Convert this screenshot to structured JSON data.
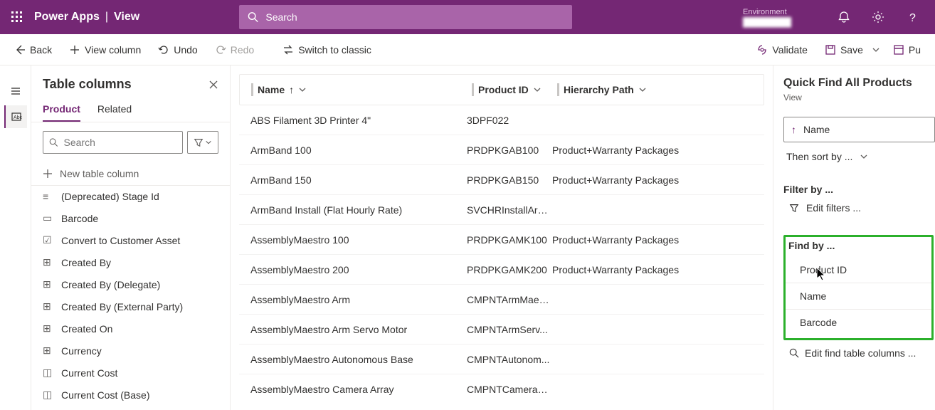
{
  "header": {
    "app_name": "Power Apps",
    "section": "View",
    "search_placeholder": "Search",
    "env_label": "Environment",
    "env_name": "████████"
  },
  "commands": {
    "back": "Back",
    "view_column": "View column",
    "undo": "Undo",
    "redo": "Redo",
    "switch": "Switch to classic",
    "validate": "Validate",
    "save": "Save",
    "publish": "Pu"
  },
  "left_pane": {
    "title": "Table columns",
    "tab_product": "Product",
    "tab_related": "Related",
    "search_placeholder": "Search",
    "new_col": "New table column",
    "items": [
      "(Deprecated) Stage Id",
      "Barcode",
      "Convert to Customer Asset",
      "Created By",
      "Created By (Delegate)",
      "Created By (External Party)",
      "Created On",
      "Currency",
      "Current Cost",
      "Current Cost (Base)"
    ]
  },
  "grid": {
    "col_name": "Name",
    "col_pid": "Product ID",
    "col_hier": "Hierarchy Path",
    "rows": [
      {
        "name": "ABS Filament 3D Printer 4\"",
        "pid": "3DPF022",
        "hier": ""
      },
      {
        "name": "ArmBand 100",
        "pid": "PRDPKGAB100",
        "hier": "Product+Warranty Packages"
      },
      {
        "name": "ArmBand 150",
        "pid": "PRDPKGAB150",
        "hier": "Product+Warranty Packages"
      },
      {
        "name": "ArmBand Install (Flat Hourly Rate)",
        "pid": "SVCHRInstallArm...",
        "hier": ""
      },
      {
        "name": "AssemblyMaestro 100",
        "pid": "PRDPKGAMK100",
        "hier": "Product+Warranty Packages"
      },
      {
        "name": "AssemblyMaestro 200",
        "pid": "PRDPKGAMK200",
        "hier": "Product+Warranty Packages"
      },
      {
        "name": "AssemblyMaestro Arm",
        "pid": "CMPNTArmMaes...",
        "hier": ""
      },
      {
        "name": "AssemblyMaestro Arm Servo Motor",
        "pid": "CMPNTArmServ...",
        "hier": ""
      },
      {
        "name": "AssemblyMaestro Autonomous Base",
        "pid": "CMPNTAutonom...",
        "hier": ""
      },
      {
        "name": "AssemblyMaestro Camera Array",
        "pid": "CMPNTCameraA...",
        "hier": ""
      }
    ]
  },
  "right_pane": {
    "title": "Quick Find All Products",
    "sub": "View",
    "sort_field": "Name",
    "then_sort": "Then sort by ...",
    "filter_label": "Filter by ...",
    "edit_filters": "Edit filters ...",
    "find_label": "Find by ...",
    "find_items": [
      "Product ID",
      "Name",
      "Barcode"
    ],
    "edit_find": "Edit find table columns ..."
  }
}
